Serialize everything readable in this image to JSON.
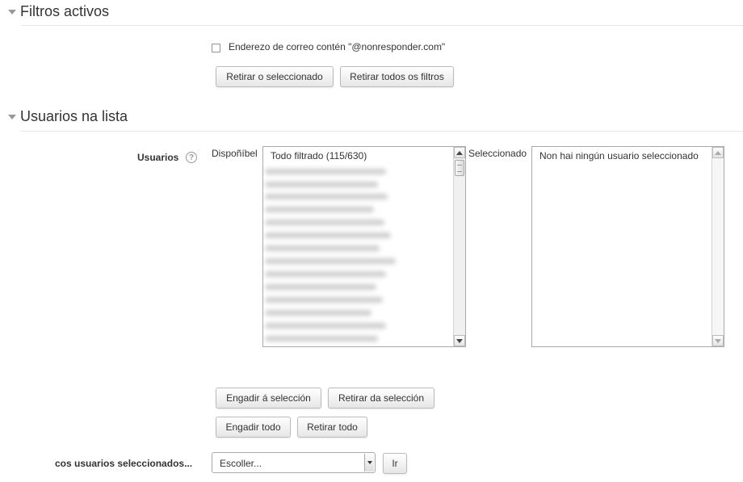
{
  "filters_section": {
    "title": "Filtros activos",
    "active_filter": "Enderezo de correo contén \"@nonresponder.com\"",
    "remove_selected_label": "Retirar o seleccionado",
    "remove_all_label": "Retirar todos os filtros"
  },
  "users_section": {
    "title": "Usuarios na lista",
    "users_label": "Usuarios",
    "help_icon": "?",
    "available_label": "Dispoñíbel",
    "available_first_option": "Todo filtrado (115/630)",
    "selected_label": "Seleccionado",
    "selected_first_option": "Non hai ningún usuario seleccionado",
    "add_to_selection_label": "Engadir á selección",
    "remove_from_selection_label": "Retirar da selección",
    "add_all_label": "Engadir todo",
    "remove_all_label": "Retirar todo"
  },
  "bulk_action": {
    "label": "cos usuarios seleccionados...",
    "select_value": "Escoller...",
    "go_label": "Ir"
  },
  "colors": {
    "text": "#333333",
    "border": "#aaaaaa",
    "rule": "#e5e5e5",
    "triangle": "#999999"
  }
}
